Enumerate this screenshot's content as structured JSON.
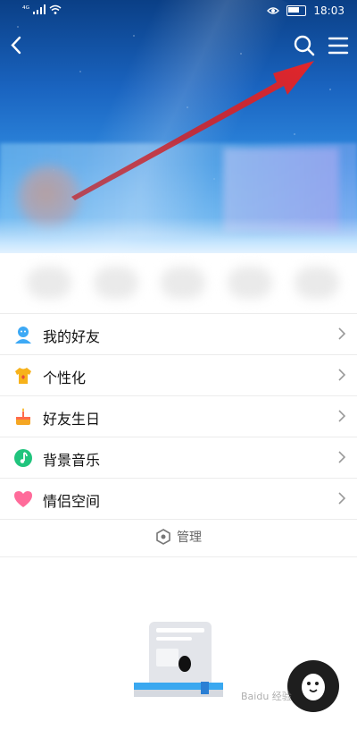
{
  "status_bar": {
    "signal_label": "⁴ᴳ",
    "time": "18:03"
  },
  "menu": {
    "items": [
      {
        "label": "我的好友",
        "icon": "friends-icon",
        "color": "#3da9f5"
      },
      {
        "label": "个性化",
        "icon": "shirt-icon",
        "color": "#f7b21a"
      },
      {
        "label": "好友生日",
        "icon": "cake-icon",
        "color": "#f5a623"
      },
      {
        "label": "背景音乐",
        "icon": "music-note-icon",
        "color": "#20c47d"
      },
      {
        "label": "情侣空间",
        "icon": "heart-icon",
        "color": "#ff6b9a"
      }
    ]
  },
  "manage": {
    "label": "管理",
    "icon": "hexagon-settings-icon"
  },
  "watermark": "Baidu 经验",
  "colors": {
    "arrow": "#e3262a",
    "divider": "#ececec",
    "fab": "#1e1e1e"
  }
}
